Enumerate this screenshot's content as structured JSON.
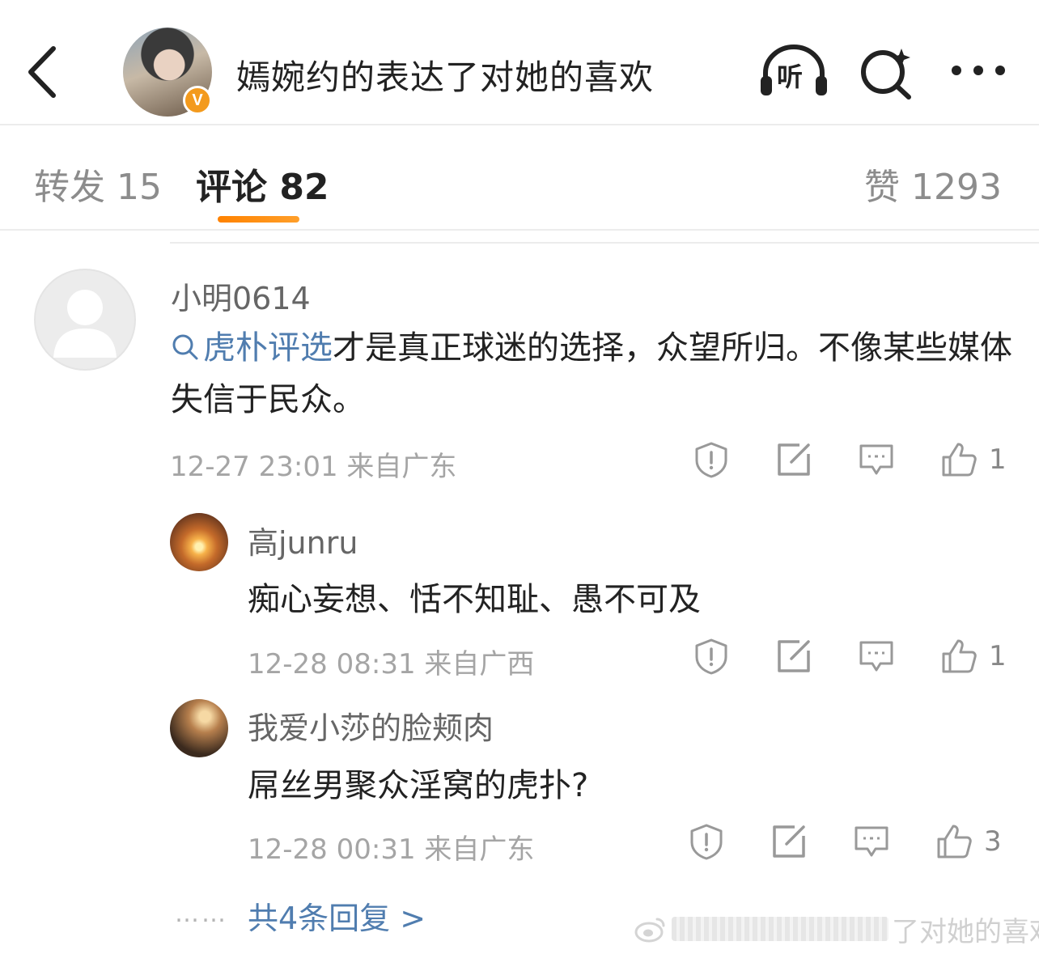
{
  "header": {
    "title": "嫣婉约的表达了对她的喜欢",
    "verified_badge": "V",
    "listen_label": "听",
    "icons": [
      "back-icon",
      "headphone-icon",
      "search-icon",
      "more-icon"
    ]
  },
  "tabs": {
    "repost": "转发 15",
    "comment": "评论 82",
    "like": "赞 1293",
    "active": "comment",
    "accent_color": "#ff8200"
  },
  "comment": {
    "username": "小明0614",
    "topic": "虎朴评选",
    "text": "才是真正球迷的选择，众望所归。不像某些媒体失信于民众。",
    "time_location": "12-27 23:01 来自广东",
    "likes": "1"
  },
  "replies": [
    {
      "username": "高junru",
      "text": "痴心妄想、恬不知耻、愚不可及",
      "time_location": "12-28 08:31 来自广西",
      "likes": "1"
    },
    {
      "username": "我爱小莎的脸颊肉",
      "text": "屌丝男聚众淫窝的虎扑?",
      "time_location": "12-28 00:31 来自广东",
      "likes": "3"
    }
  ],
  "more_replies": {
    "dots": "……",
    "label": "共4条回复 >"
  },
  "watermark": {
    "text": "了对她的喜欢"
  },
  "colors": {
    "link": "#507daf",
    "badge": "#f39a1d",
    "meta": "#a5a5a5"
  }
}
